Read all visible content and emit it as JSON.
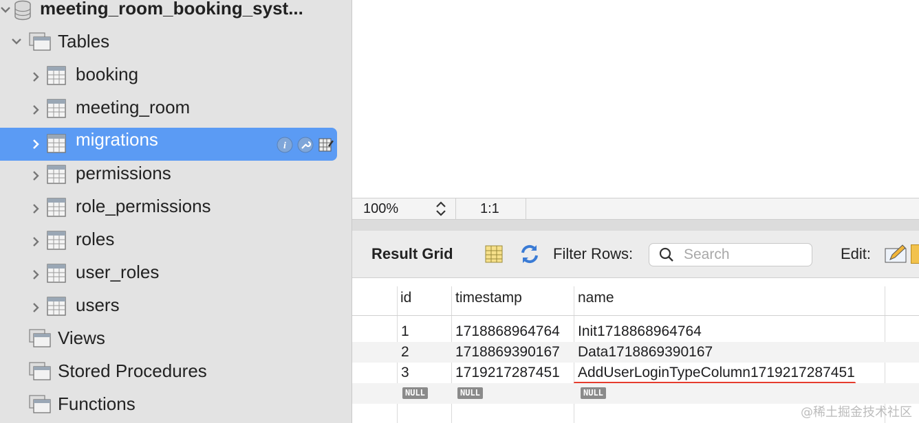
{
  "sidebar": {
    "database": "meeting_room_booking_syst...",
    "tables_group": "Tables",
    "tables": [
      "booking",
      "meeting_room",
      "migrations",
      "permissions",
      "role_permissions",
      "roles",
      "user_roles",
      "users"
    ],
    "selected_table": "migrations",
    "groups": [
      "Views",
      "Stored Procedures",
      "Functions"
    ]
  },
  "statusbar": {
    "zoom": "100%",
    "ratio": "1:1"
  },
  "result": {
    "title": "Result Grid",
    "filter_label": "Filter Rows:",
    "search_placeholder": "Search",
    "edit_label": "Edit:",
    "columns": [
      "id",
      "timestamp",
      "name"
    ],
    "rows": [
      [
        "1",
        "1718868964764",
        "Init1718868964764"
      ],
      [
        "2",
        "1718869390167",
        "Data1718869390167"
      ],
      [
        "3",
        "1719217287451",
        "AddUserLoginTypeColumn1719217287451"
      ]
    ],
    "null_label": "NULL"
  },
  "watermark": "@稀土掘金技术社区",
  "colors": {
    "selection": "#5b9bf4",
    "highlight_underline": "#e53b2c"
  }
}
